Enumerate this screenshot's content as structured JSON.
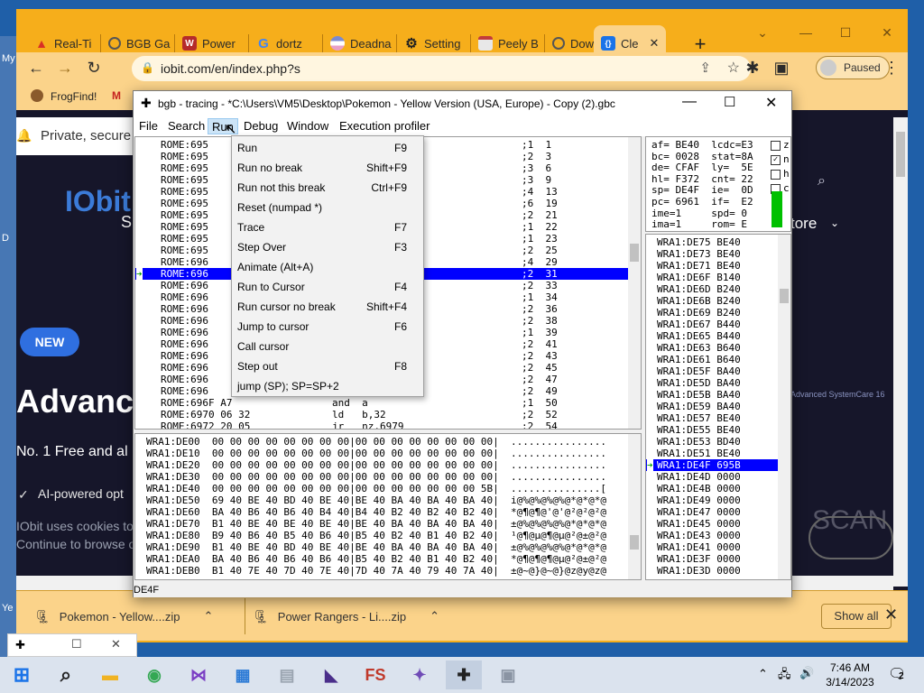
{
  "desktop": {
    "left_label": "My",
    "side_mark": "D",
    "taskbar_label": "Ye"
  },
  "chrome": {
    "tabs": [
      {
        "label": "Real-Ti",
        "icon": "warning-icon",
        "color": "#d93025"
      },
      {
        "label": "BGB Ga",
        "icon": "globe-icon",
        "color": "#555555"
      },
      {
        "label": "Power",
        "icon": "w-icon",
        "color": "#b52b2b"
      },
      {
        "label": "dortz",
        "icon": "google-icon",
        "color": "#4285f4"
      },
      {
        "label": "Deadna",
        "icon": "stripes-icon",
        "color": "#7a8ad0"
      },
      {
        "label": "Setting",
        "icon": "gear-icon",
        "color": "#222222"
      },
      {
        "label": "Peely B",
        "icon": "page-icon",
        "color": "#c23b3b"
      },
      {
        "label": "Downlo",
        "icon": "globe-icon",
        "color": "#555555"
      },
      {
        "label": "Cle",
        "icon": "code-icon",
        "color": "#1a73e8"
      }
    ],
    "url": "iobit.com/en/index.php?s",
    "profile_label": "Paused",
    "bookmarks": [
      "FrogFind!",
      "M"
    ],
    "page": {
      "banner_text": "Private, secure",
      "logo": "IObit",
      "logo_sub": "S",
      "store": "tore",
      "badge": "NEW",
      "headline": "Advance",
      "subline": "No. 1 Free and al",
      "ai_line": "AI-powered opt",
      "cookie_line1": "IObit uses cookies to",
      "cookie_line2": "Continue to browse o",
      "watermark": "Advanced SystemCare 16",
      "scan": "SCAN"
    },
    "downloads": [
      {
        "name": "Pokemon - Yellow....zip"
      },
      {
        "name": "Power Rangers - Li....zip"
      }
    ],
    "show_all": "Show all"
  },
  "bgb": {
    "title": "bgb - tracing - *C:\\Users\\VM5\\Desktop\\Pokemon - Yellow Version (USA, Europe) - Copy (2).gbc",
    "menu": [
      "File",
      "Search",
      "Run",
      "Debug",
      "Window",
      "Execution profiler"
    ],
    "disasm": [
      {
        "addr": "ROME:695",
        "code": "",
        "cyc": ";1  1"
      },
      {
        "addr": "ROME:695",
        "code": "",
        "cyc": ";2  3"
      },
      {
        "addr": "ROME:695",
        "code": "",
        "cyc": ";3  6"
      },
      {
        "addr": "ROME:695",
        "code": "",
        "cyc": ";3  9"
      },
      {
        "addr": "ROME:695",
        "code": "",
        "cyc": ";4  13"
      },
      {
        "addr": "ROME:695",
        "code": "",
        "cyc": ";6  19"
      },
      {
        "addr": "ROME:695",
        "code": "",
        "cyc": ";2  21"
      },
      {
        "addr": "ROME:695",
        "code": "",
        "cyc": ";1  22"
      },
      {
        "addr": "ROME:695",
        "code": "",
        "cyc": ";1  23"
      },
      {
        "addr": "ROME:695",
        "code": "",
        "cyc": ";2  25"
      },
      {
        "addr": "ROME:696",
        "code": "",
        "cyc": ";4  29"
      },
      {
        "addr": "ROME:696",
        "code": "",
        "cyc": ";2  31"
      },
      {
        "addr": "ROME:696",
        "code": "",
        "cyc": ";2  33"
      },
      {
        "addr": "ROME:696",
        "code": "",
        "cyc": ";1  34"
      },
      {
        "addr": "ROME:696",
        "code": "",
        "cyc": ";2  36"
      },
      {
        "addr": "ROME:696",
        "code": "",
        "cyc": ";2  38"
      },
      {
        "addr": "ROME:696",
        "code": "",
        "cyc": ";1  39"
      },
      {
        "addr": "ROME:696",
        "code": "",
        "cyc": ";2  41"
      },
      {
        "addr": "ROME:696",
        "code": "",
        "cyc": ";2  43"
      },
      {
        "addr": "ROME:696",
        "code": "",
        "cyc": ";2  45"
      },
      {
        "addr": "ROME:696",
        "code": "",
        "cyc": ";2  47"
      },
      {
        "addr": "ROME:696",
        "code": "",
        "cyc": ";2  49"
      },
      {
        "addr": "ROME:696F A7",
        "code": "and  a",
        "cyc": ";1  50"
      },
      {
        "addr": "ROME:6970 06 32",
        "code": "ld   b,32",
        "cyc": ";2  52"
      },
      {
        "addr": "ROME:6972 20 05",
        "code": "jr   nz,6979",
        "cyc": ";2  54"
      }
    ],
    "registers": [
      "af= BE40  lcdc=E3",
      "bc= 0028  stat=8A",
      "de= CFAF  ly=  5E",
      "hl= F372  cnt= 22",
      "sp= DE4F  ie=  0D",
      "pc= 6961  if=  E2",
      "ime=1     spd= 0",
      "ima=1     rom= E"
    ],
    "flags": [
      "z",
      "n",
      "h",
      "c"
    ],
    "stack": [
      "WRA1:DE75 BE40",
      "WRA1:DE73 BE40",
      "WRA1:DE71 BE40",
      "WRA1:DE6F B140",
      "WRA1:DE6D B240",
      "WRA1:DE6B B240",
      "WRA1:DE69 B240",
      "WRA1:DE67 B440",
      "WRA1:DE65 B440",
      "WRA1:DE63 B640",
      "WRA1:DE61 B640",
      "WRA1:DE5F BA40",
      "WRA1:DE5D BA40",
      "WRA1:DE5B BA40",
      "WRA1:DE59 BA40",
      "WRA1:DE57 BE40",
      "WRA1:DE55 BE40",
      "WRA1:DE53 BD40",
      "WRA1:DE51 BE40",
      "WRA1:DE4F 695B",
      "WRA1:DE4D 0000",
      "WRA1:DE4B 0000",
      "WRA1:DE49 0000",
      "WRA1:DE47 0000",
      "WRA1:DE45 0000",
      "WRA1:DE43 0000",
      "WRA1:DE41 0000",
      "WRA1:DE3F 0000",
      "WRA1:DE3D 0000"
    ],
    "memory": [
      "WRA1:DE00  00 00 00 00 00 00 00 00|00 00 00 00 00 00 00 00|  ................",
      "WRA1:DE10  00 00 00 00 00 00 00 00|00 00 00 00 00 00 00 00|  ................",
      "WRA1:DE20  00 00 00 00 00 00 00 00|00 00 00 00 00 00 00 00|  ................",
      "WRA1:DE30  00 00 00 00 00 00 00 00|00 00 00 00 00 00 00 00|  ................",
      "WRA1:DE40  00 00 00 00 00 00 00 00|00 00 00 00 00 00 00 5B|  ...............[",
      "WRA1:DE50  69 40 BE 40 BD 40 BE 40|BE 40 BA 40 BA 40 BA 40|  i@%@%@%@%@*@*@*@",
      "WRA1:DE60  BA 40 B6 40 B6 40 B4 40|B4 40 B2 40 B2 40 B2 40|  *@¶@¶@'@'@²@²@²@",
      "WRA1:DE70  B1 40 BE 40 BE 40 BE 40|BE 40 BA 40 BA 40 BA 40|  ±@%@%@%@%@*@*@*@",
      "WRA1:DE80  B9 40 B6 40 B5 40 B6 40|B5 40 B2 40 B1 40 B2 40|  ¹@¶@µ@¶@µ@²@±@²@",
      "WRA1:DE90  B1 40 BE 40 BD 40 BE 40|BE 40 BA 40 BA 40 BA 40|  ±@%@%@%@%@*@*@*@",
      "WRA1:DEA0  BA 40 B6 40 B6 40 B6 40|B5 40 B2 40 B1 40 B2 40|  *@¶@¶@¶@µ@²@±@²@",
      "WRA1:DEB0  B1 40 7E 40 7D 40 7E 40|7D 40 7A 40 79 40 7A 40|  ±@~@}@~@}@z@y@z@"
    ],
    "status": "DE4F",
    "run_menu": [
      {
        "label": "Run",
        "shortcut": "F9"
      },
      {
        "label": "Run no break",
        "shortcut": "Shift+F9"
      },
      {
        "label": "Run not this break",
        "shortcut": "Ctrl+F9"
      },
      {
        "label": "Reset (numpad *)",
        "shortcut": ""
      },
      {
        "label": "Trace",
        "shortcut": "F7"
      },
      {
        "label": "Step Over",
        "shortcut": "F3"
      },
      {
        "label": "Animate (Alt+A)",
        "shortcut": ""
      },
      {
        "label": "Run to Cursor",
        "shortcut": "F4"
      },
      {
        "label": "Run cursor no break",
        "shortcut": "Shift+F4"
      },
      {
        "label": "Jump to cursor",
        "shortcut": "F6"
      },
      {
        "label": "Call cursor",
        "shortcut": ""
      },
      {
        "label": "Step out",
        "shortcut": "F8"
      },
      {
        "label": "jump (SP); SP=SP+2",
        "shortcut": ""
      }
    ]
  },
  "taskbar": {
    "time": "7:46 AM",
    "date": "3/14/2023",
    "notification_count": "2",
    "apps": [
      {
        "name": "start-icon",
        "color": "#1a73e8"
      },
      {
        "name": "search-icon",
        "color": "#222222"
      },
      {
        "name": "file-explorer-icon",
        "color": "#f0b323"
      },
      {
        "name": "chrome-icon",
        "color": "#34a853"
      },
      {
        "name": "visual-studio-icon",
        "color": "#7b3fc4"
      },
      {
        "name": "calculator-icon",
        "color": "#2d7bd6"
      },
      {
        "name": "notepad-icon",
        "color": "#9aa4b0"
      },
      {
        "name": "app-triangle-icon",
        "color": "#4a2e8a"
      },
      {
        "name": "fs-icon",
        "color": "#c0392b"
      },
      {
        "name": "game-icon",
        "color": "#6f4bb6"
      },
      {
        "name": "bgb-icon",
        "color": "#222222"
      },
      {
        "name": "vm-icon",
        "color": "#8a94a3"
      }
    ]
  }
}
